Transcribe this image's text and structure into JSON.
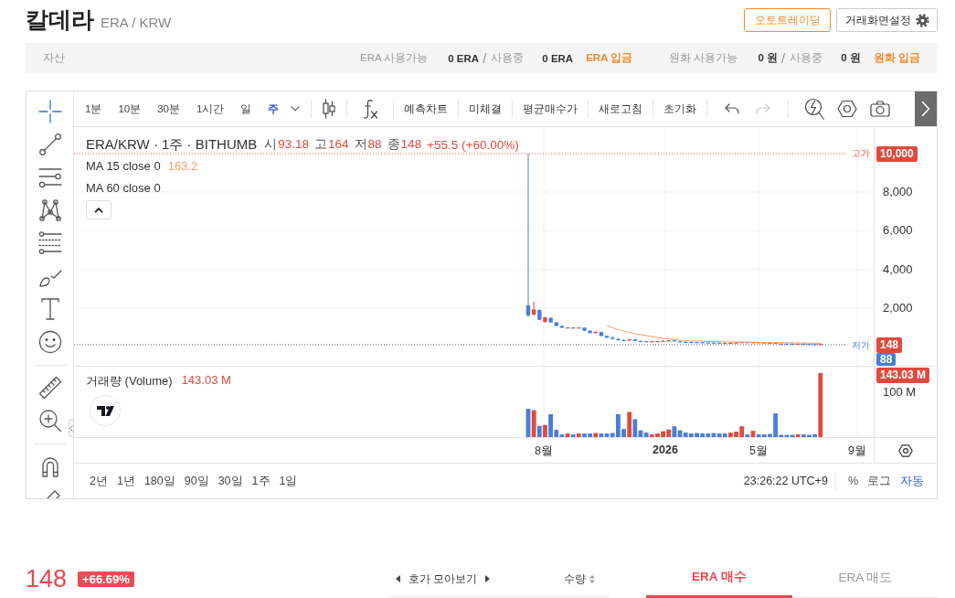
{
  "header": {
    "title": "칼데라",
    "pair": "ERA / KRW",
    "buttons": [
      {
        "kind": "outline",
        "label": "오토트레이딩"
      },
      {
        "kind": "settings",
        "label": "거래화면설정"
      }
    ]
  },
  "assets": {
    "label": "자산",
    "groups": [
      {
        "available_label": "ERA 사용가능",
        "available": "0 ERA",
        "separator": "/",
        "in_use_label": "사용중",
        "in_use": "0 ERA",
        "deposit": "ERA 입금"
      },
      {
        "available_label": "원화 사용가능",
        "available": "0 원",
        "separator": "/",
        "in_use_label": "사용중",
        "in_use": "0 원",
        "deposit": "원화 입금"
      }
    ]
  },
  "chart": {
    "drawing_tool_groups": [
      {
        "tools": [
          {
            "kind": "crosshair",
            "selected": true
          },
          {
            "kind": "trend-line",
            "selected": false
          },
          {
            "kind": "horizontal-lines",
            "selected": false
          },
          {
            "kind": "pattern",
            "selected": false
          },
          {
            "kind": "level-lines",
            "selected": false
          },
          {
            "kind": "brush",
            "selected": false
          },
          {
            "kind": "text",
            "selected": false
          },
          {
            "kind": "emoji",
            "selected": false
          }
        ]
      },
      {
        "tools": [
          {
            "kind": "ruler",
            "selected": false
          },
          {
            "kind": "zoom-in",
            "selected": false
          }
        ]
      },
      {
        "tools": [
          {
            "kind": "magnet",
            "selected": false
          },
          {
            "kind": "pencil",
            "selected": false
          }
        ]
      }
    ],
    "intervals": [
      {
        "label": "1분",
        "selected": false
      },
      {
        "label": "10분",
        "selected": false
      },
      {
        "label": "30분",
        "selected": false
      },
      {
        "label": "1시간",
        "selected": false
      },
      {
        "label": "일",
        "selected": false
      },
      {
        "label": "주",
        "selected": true
      }
    ],
    "actions": [
      "예측차트",
      "미체결",
      "평균매수가",
      "새로고침",
      "초기화"
    ],
    "history": [
      {
        "kind": "undo",
        "disabled": false
      },
      {
        "kind": "redo",
        "disabled": true
      }
    ],
    "legend": {
      "symbol": "ERA/KRW · 1주 · BITHUMB",
      "ohlc": [
        {
          "label": "시",
          "value": "93.18"
        },
        {
          "label": "고",
          "value": "164"
        },
        {
          "label": "저",
          "value": "88"
        },
        {
          "label": "종",
          "value": "148"
        }
      ],
      "change": "+55.5 (+60.00%)"
    },
    "indicators": [
      {
        "name": "MA 15 close 0",
        "value": "163.2"
      },
      {
        "name": "MA 60 close 0"
      }
    ],
    "price_axis": {
      "high_label": "고가",
      "high_tag": "10,000",
      "ticks": [
        "8,000",
        "6,000",
        "4,000",
        "2,000"
      ],
      "low_label": "저가",
      "last_tag": "148",
      "low_tag": "88"
    },
    "volume": {
      "title": "거래량 (Volume)",
      "value": "143.03 M",
      "last_tag": "143.03 M",
      "ticks": [
        "100 M"
      ]
    },
    "time_axis": [
      {
        "kind": "month",
        "label": "8월"
      },
      {
        "kind": "year",
        "label": "2026"
      },
      {
        "kind": "month",
        "label": "5월"
      },
      {
        "kind": "month",
        "label": "9월"
      }
    ],
    "ranges": [
      "2년",
      "1년",
      "180일",
      "90일",
      "30일",
      "1주",
      "1일"
    ],
    "clock": "23:26:22 UTC+9",
    "scale_modes": [
      {
        "label": "%",
        "selected": false
      },
      {
        "label": "로그",
        "selected": false
      },
      {
        "label": "자동",
        "selected": true
      }
    ]
  },
  "ticker": {
    "price": "148",
    "change": "+66.69%"
  },
  "orderbook": {
    "grouping": "호가 모아보기",
    "sort_column": "수량"
  },
  "order_tabs": [
    {
      "label": "ERA 매수",
      "selected": true
    },
    {
      "label": "ERA 매도",
      "selected": false
    }
  ]
}
